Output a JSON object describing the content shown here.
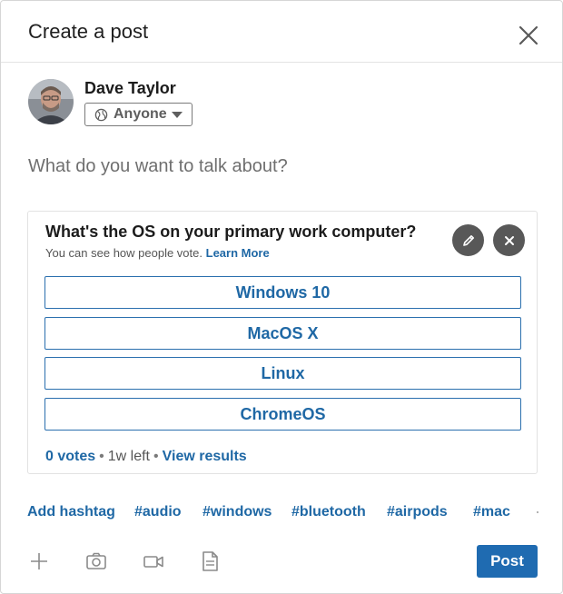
{
  "header": {
    "title": "Create a post",
    "close_icon": "close-icon"
  },
  "author": {
    "name": "Dave Taylor",
    "avatar_icon": "avatar",
    "visibility": {
      "icon": "globe-icon",
      "label": "Anyone"
    }
  },
  "compose": {
    "placeholder": "What do you want to talk about?"
  },
  "poll": {
    "question": "What's the OS on your primary work computer?",
    "subtitle": "You can see how people vote.",
    "learn_more": "Learn More",
    "edit_icon": "pencil-icon",
    "remove_icon": "close-icon",
    "options": [
      "Windows 10",
      "MacOS X",
      "Linux",
      "ChromeOS"
    ],
    "votes": "0 votes",
    "time_left": "1w left",
    "view_results": "View results"
  },
  "hashtags": {
    "add_label": "Add hashtag",
    "tags": [
      "#audio",
      "#windows",
      "#bluetooth",
      "#airpods",
      "#mac"
    ]
  },
  "toolbar": {
    "icons": [
      "plus-icon",
      "camera-icon",
      "video-icon",
      "document-icon"
    ],
    "post_label": "Post"
  },
  "colors": {
    "accent": "#1f68a5",
    "post_button": "#1f6bb1",
    "poll_icon_bg": "#585858"
  }
}
